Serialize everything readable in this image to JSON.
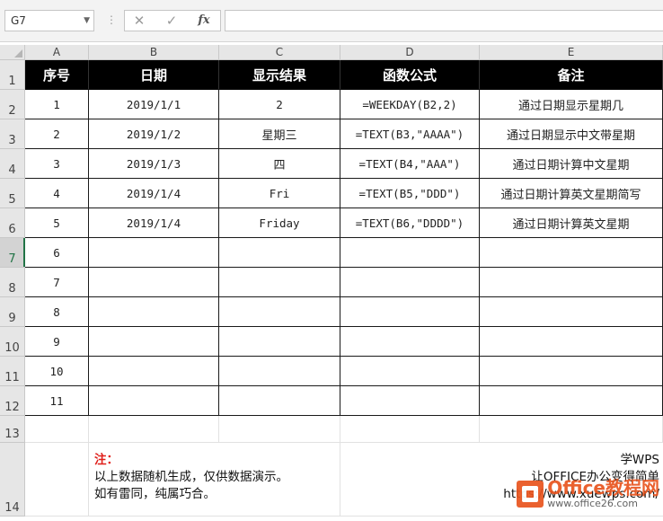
{
  "formula_bar": {
    "name_box": "G7",
    "cancel_icon": "close-icon",
    "enter_icon": "check-icon",
    "function_label": "fx",
    "formula": ""
  },
  "columns": [
    "A",
    "B",
    "C",
    "D",
    "E"
  ],
  "rows": [
    "1",
    "2",
    "3",
    "4",
    "5",
    "6",
    "7",
    "8",
    "9",
    "10",
    "11",
    "12",
    "13",
    "14"
  ],
  "active_row": "7",
  "table": {
    "headers": [
      "序号",
      "日期",
      "显示结果",
      "函数公式",
      "备注"
    ],
    "rows": [
      [
        "1",
        "2019/1/1",
        "2",
        "=WEEKDAY(B2,2)",
        "通过日期显示星期几"
      ],
      [
        "2",
        "2019/1/2",
        "星期三",
        "=TEXT(B3,\"AAAA\")",
        "通过日期显示中文带星期"
      ],
      [
        "3",
        "2019/1/3",
        "四",
        "=TEXT(B4,\"AAA\")",
        "通过日期计算中文星期"
      ],
      [
        "4",
        "2019/1/4",
        "Fri",
        "=TEXT(B5,\"DDD\")",
        "通过日期计算英文星期简写"
      ],
      [
        "5",
        "2019/1/4",
        "Friday",
        "=TEXT(B6,\"DDDD\")",
        "通过日期计算英文星期"
      ],
      [
        "6",
        "",
        "",
        "",
        ""
      ],
      [
        "7",
        "",
        "",
        "",
        ""
      ],
      [
        "8",
        "",
        "",
        "",
        ""
      ],
      [
        "9",
        "",
        "",
        "",
        ""
      ],
      [
        "10",
        "",
        "",
        "",
        ""
      ],
      [
        "11",
        "",
        "",
        "",
        ""
      ]
    ]
  },
  "note": {
    "title": "注：",
    "line1": "以上数据随机生成，仅供数据演示。",
    "line2": "如有雷同，纯属巧合。"
  },
  "brand": {
    "line1": "学WPS",
    "line2": "让OFFICE办公变得简单",
    "line3": "https://www.xuewps.com/"
  },
  "watermark": {
    "main": "Office教程网",
    "sub": "www.office26.com"
  },
  "colors": {
    "header_bg": "#000000",
    "header_text": "#ffffff",
    "note_title": "#e0201b",
    "active_row": "#217346"
  }
}
